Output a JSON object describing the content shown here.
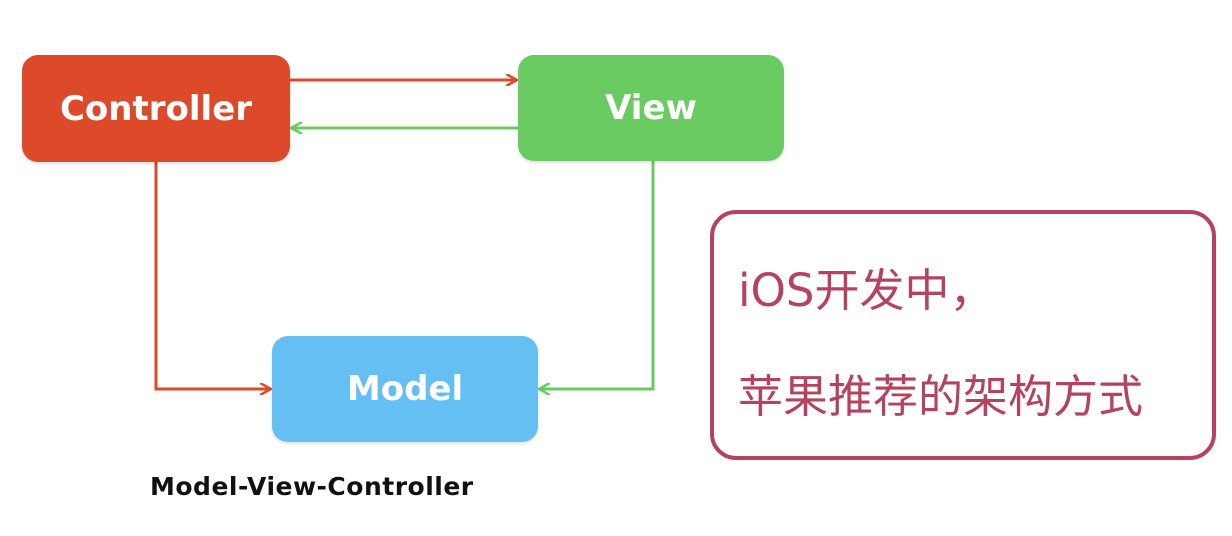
{
  "diagram": {
    "nodes": {
      "controller": {
        "label": "Controller",
        "color": "#dc4a2a"
      },
      "view": {
        "label": "View",
        "color": "#6bcb63"
      },
      "model": {
        "label": "Model",
        "color": "#66bff2"
      }
    },
    "edges": [
      {
        "from": "controller",
        "to": "view",
        "color": "#dc4a2a"
      },
      {
        "from": "view",
        "to": "controller",
        "color": "#6bcb63"
      },
      {
        "from": "controller",
        "to": "model",
        "color": "#dc4a2a"
      },
      {
        "from": "view",
        "to": "model",
        "color": "#6bcb63"
      }
    ],
    "caption": "Model-View-Controller"
  },
  "note": {
    "line1": "iOS开发中，",
    "line2": "苹果推荐的架构方式",
    "border_color": "#b5435f"
  }
}
